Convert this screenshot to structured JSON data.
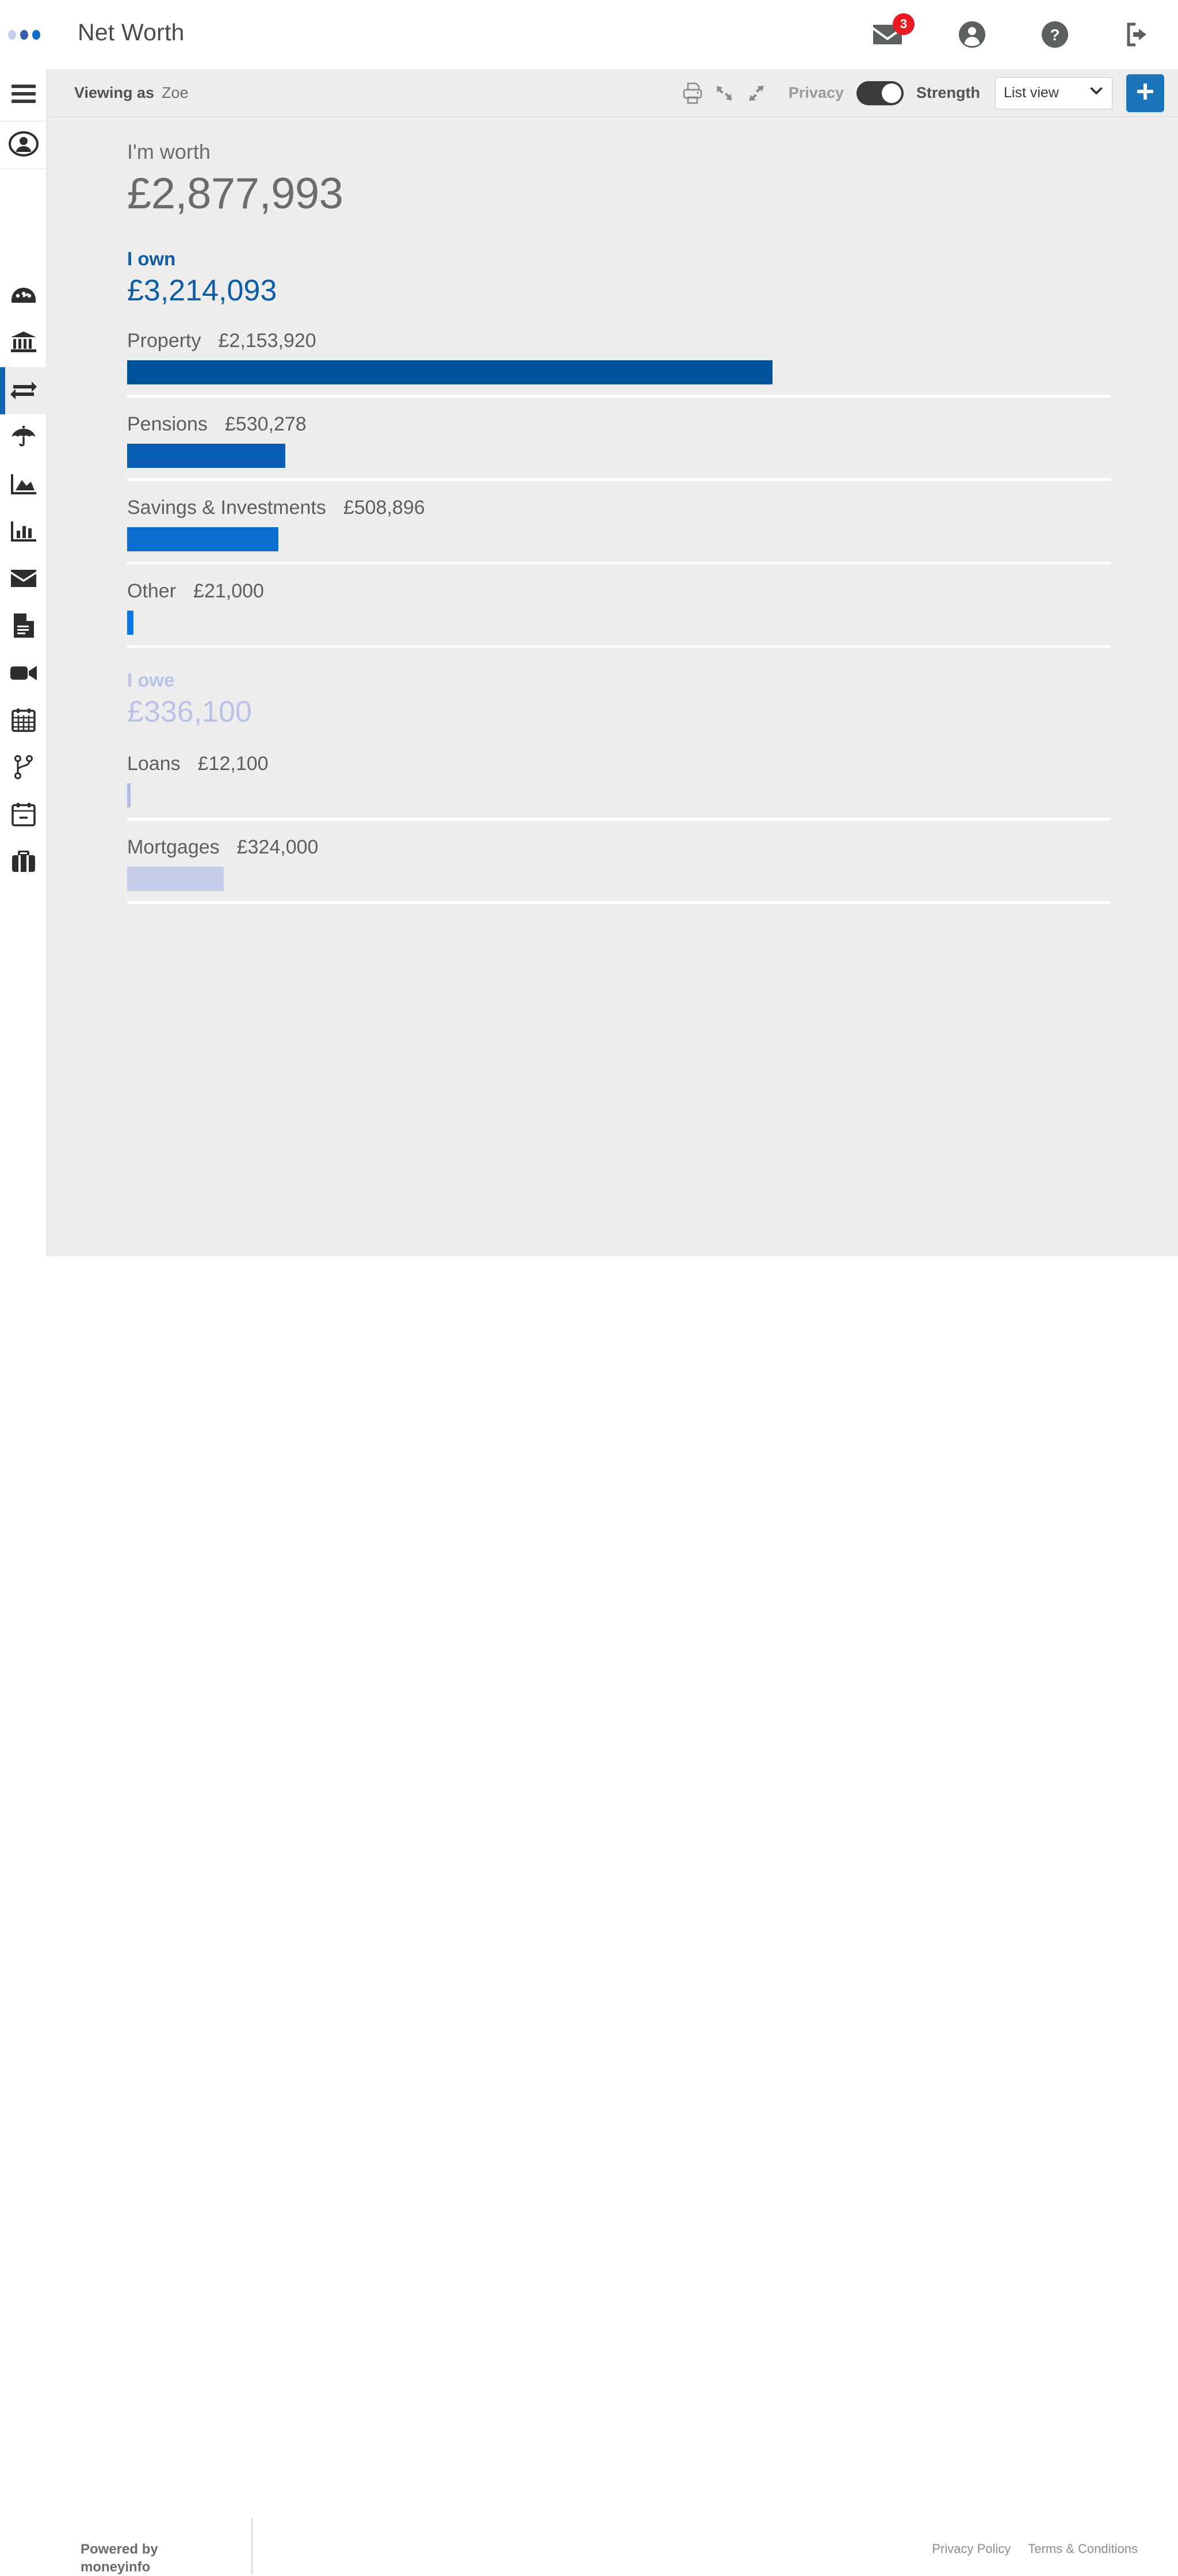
{
  "header": {
    "title": "Net Worth",
    "logo_dots": [
      "#c5cdea",
      "#3b5fae",
      "#0f6fc7"
    ],
    "icons": [
      {
        "name": "messages-icon",
        "glyph": "envelope",
        "badge": "3"
      },
      {
        "name": "account-icon",
        "glyph": "user-circle"
      },
      {
        "name": "help-icon",
        "glyph": "question-circle"
      },
      {
        "name": "logout-icon",
        "glyph": "sign-out"
      }
    ]
  },
  "sidebar": {
    "items": [
      {
        "name": "menu-toggle",
        "icon": "hamburger-icon",
        "active": false
      },
      {
        "name": "profile",
        "icon": "user-circle-icon",
        "active": false
      },
      {
        "name": "dashboard",
        "icon": "speedometer-icon",
        "active": false
      },
      {
        "name": "banking",
        "icon": "bank-icon",
        "active": false
      },
      {
        "name": "transactions",
        "icon": "exchange-arrows-icon",
        "active": true
      },
      {
        "name": "protection",
        "icon": "umbrella-icon",
        "active": false
      },
      {
        "name": "investments",
        "icon": "area-chart-icon",
        "active": false
      },
      {
        "name": "reports",
        "icon": "bar-chart-icon",
        "active": false
      },
      {
        "name": "messages",
        "icon": "envelope-icon",
        "active": false
      },
      {
        "name": "documents",
        "icon": "document-icon",
        "active": false
      },
      {
        "name": "video",
        "icon": "video-camera-icon",
        "active": false
      },
      {
        "name": "calendar",
        "icon": "calendar-grid-icon",
        "active": false
      },
      {
        "name": "workflow",
        "icon": "branch-icon",
        "active": false
      },
      {
        "name": "events",
        "icon": "calendar-minus-icon",
        "active": false
      },
      {
        "name": "business",
        "icon": "briefcase-icon",
        "active": false
      }
    ]
  },
  "toolbar": {
    "viewing_as_label": "Viewing as",
    "viewing_as_user": "Zoe",
    "print_icon": "print-icon",
    "collapse_icon": "collapse-icon",
    "expand_icon": "expand-icon",
    "privacy_label": "Privacy",
    "strength_label": "Strength",
    "toggle_state": "on",
    "view_select_value": "List view",
    "view_select_options": [
      "List view"
    ],
    "add_button_label": "+"
  },
  "networth": {
    "worth_label": "I'm worth",
    "worth_value": "£2,877,993",
    "own": {
      "title": "I own",
      "value": "£3,214,093"
    },
    "owe": {
      "title": "I owe",
      "value": "£336,100"
    }
  },
  "chart_data": {
    "type": "bar",
    "title": "Net Worth breakdown",
    "orientation": "horizontal",
    "xlabel": "",
    "ylabel": "",
    "axis_max": 2153920,
    "groups": [
      {
        "name": "I own",
        "total": 3214093,
        "total_label": "£3,214,093",
        "color": "#0d5ca8",
        "categories": [
          "Property",
          "Pensions",
          "Savings & Investments",
          "Other"
        ],
        "values": [
          2153920,
          530278,
          508896,
          21000
        ],
        "value_labels": [
          "£2,153,920",
          "£530,278",
          "£508,896",
          "£21,000"
        ],
        "colors": [
          "#00529c",
          "#0a5fb5",
          "#0a6fd0",
          "#0a78e6"
        ],
        "bar_widths_pct": [
          65.6,
          16.1,
          15.4,
          0.62
        ]
      },
      {
        "name": "I owe",
        "total": 336100,
        "total_label": "£336,100",
        "color": "#bbc2e8",
        "categories": [
          "Loans",
          "Mortgages"
        ],
        "values": [
          12100,
          324000
        ],
        "value_labels": [
          "£12,100",
          "£324,000"
        ],
        "colors": [
          "#b3bbe4",
          "#c8cee9"
        ],
        "bar_widths_pct": [
          0.36,
          9.8
        ]
      }
    ]
  },
  "footer": {
    "powered_by_line1": "Powered by",
    "powered_by_line2": "moneyinfo",
    "links": [
      {
        "label": "Privacy Policy"
      },
      {
        "label": "Terms & Conditions"
      }
    ]
  }
}
